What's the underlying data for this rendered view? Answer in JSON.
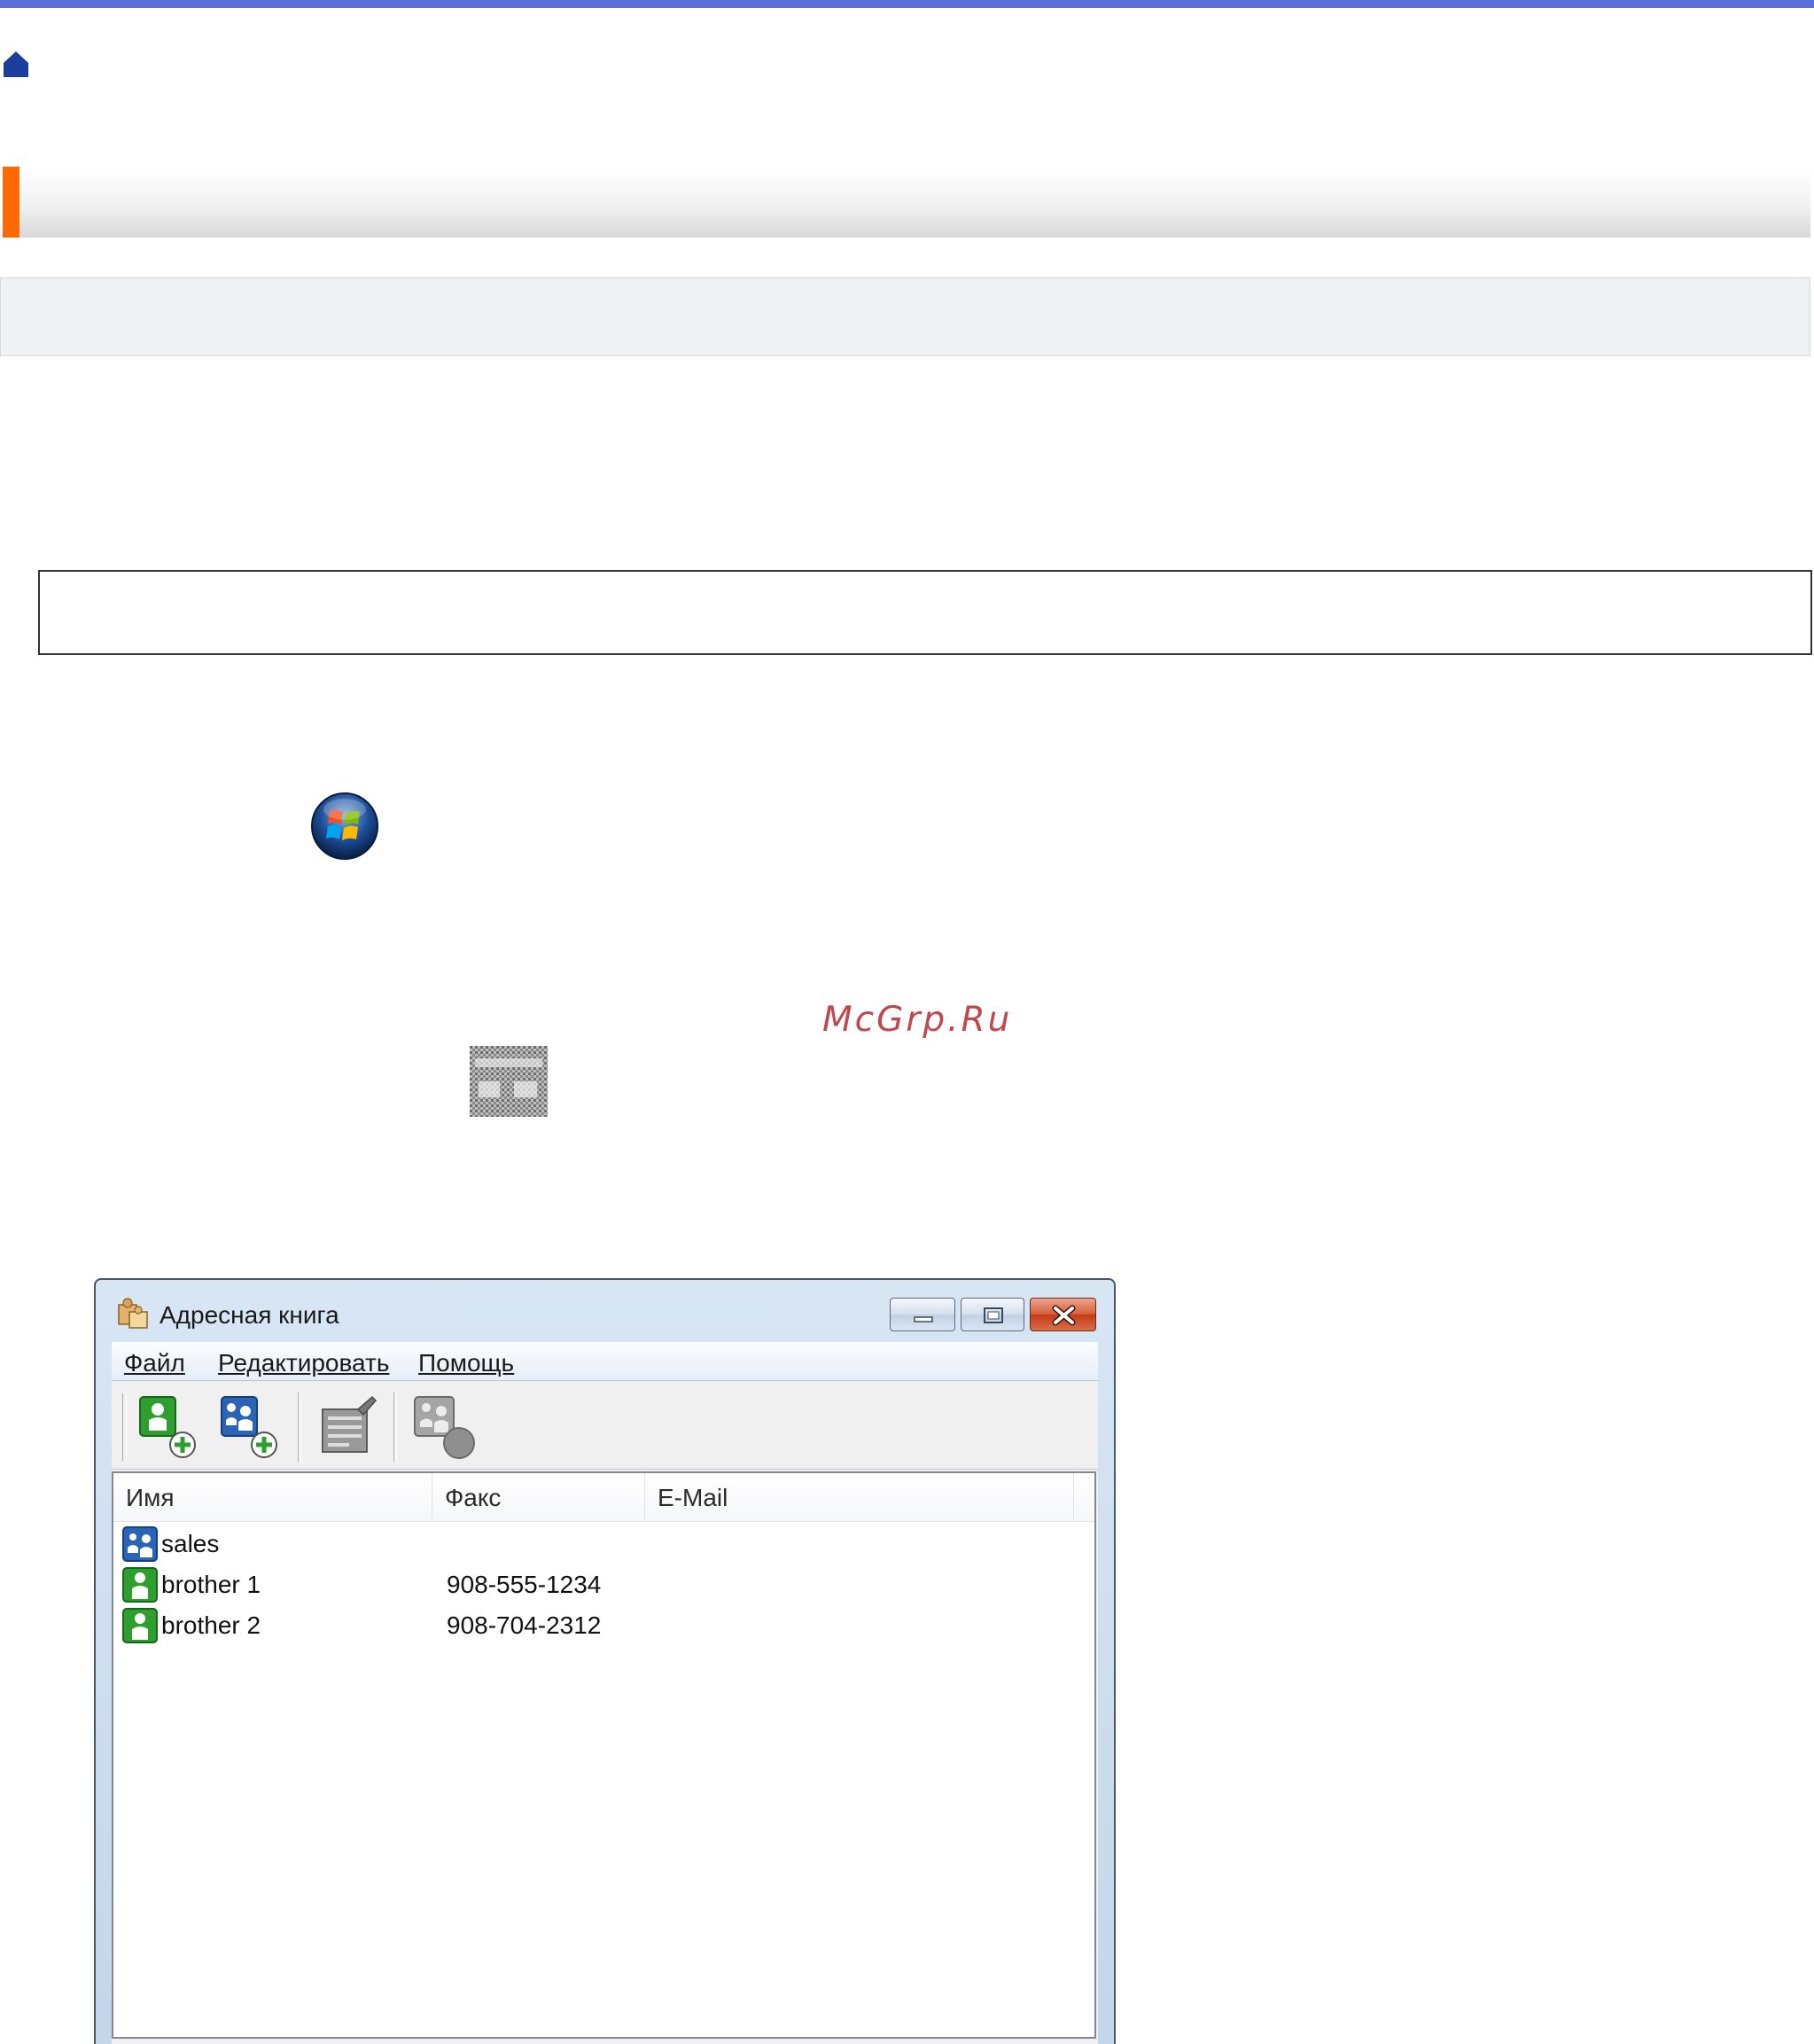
{
  "watermark": "McGrp.Ru",
  "icons": {
    "home": "home-icon",
    "start": "windows-start-orb-icon",
    "address_book_button": "address-book-button-icon"
  },
  "colors": {
    "top_bar": "#5b6fdc",
    "heading_accent": "#ff6a00",
    "watermark": "#c0474b"
  },
  "window": {
    "title": "Адресная книга",
    "menu": [
      {
        "label": "Файл"
      },
      {
        "label": "Редактировать"
      },
      {
        "label": "Помощь"
      }
    ],
    "toolbar": [
      {
        "name": "add-member-button",
        "icon": "add-member-icon"
      },
      {
        "name": "add-group-button",
        "icon": "add-group-icon"
      },
      {
        "name": "edit-button",
        "icon": "edit-icon"
      },
      {
        "name": "delete-button",
        "icon": "delete-icon"
      }
    ],
    "columns": [
      "Имя",
      "Факс",
      "E-Mail"
    ],
    "rows": [
      {
        "type": "group",
        "name": "sales",
        "fax": "",
        "email": ""
      },
      {
        "type": "member",
        "name": "brother 1",
        "fax": "908-555-1234",
        "email": ""
      },
      {
        "type": "member",
        "name": "brother 2",
        "fax": "908-704-2312",
        "email": ""
      }
    ]
  }
}
